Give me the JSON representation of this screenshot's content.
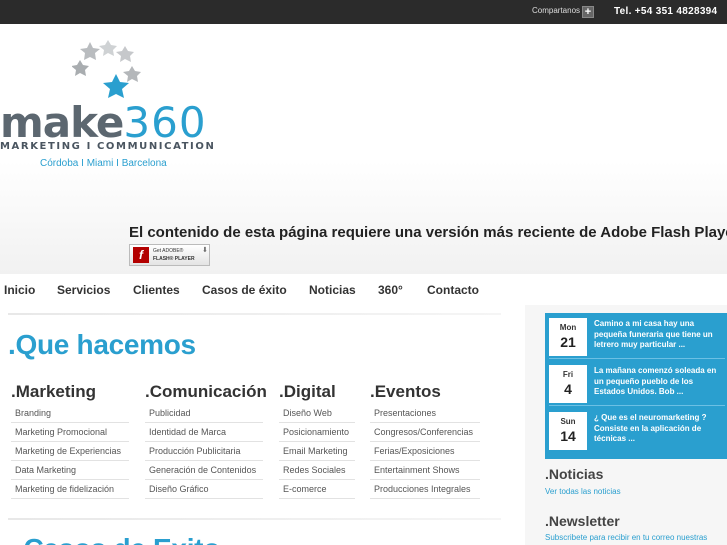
{
  "topbar": {
    "share_label": "Compartanos",
    "phone": "Tel. +54 351 4828394"
  },
  "logo": {
    "name_part1": "make",
    "name_part2": "360",
    "tagline": "MARKETING I COMMUNICATION",
    "cities": "Córdoba  I  Miami  I  Barcelona"
  },
  "flash": {
    "message": "El contenido de esta página requiere una versión más reciente de Adobe Flash Player.",
    "button_line1": "Get ADOBE®",
    "button_line2": "FLASH® PLAYER"
  },
  "nav": [
    "Inicio",
    "Servicios",
    "Clientes",
    "Casos de éxito",
    "Noticias",
    "360°",
    "Contacto"
  ],
  "main": {
    "title": ".Que hacemos",
    "next_title": ".Casos de Exito",
    "columns": [
      {
        "title": ".Marketing",
        "items": [
          "Branding",
          "Marketing Promocional",
          "Marketing de Experiencias",
          "Data Marketing",
          "Marketing de fidelización"
        ]
      },
      {
        "title": ".Comunicación",
        "items": [
          "Publicidad",
          "Identidad de Marca",
          "Producción Publicitaria",
          "Generación de Contenidos",
          "Diseño Gráfico"
        ]
      },
      {
        "title": ".Digital",
        "items": [
          "Diseño Web",
          "Posicionamiento",
          "Email Marketing",
          "Redes Sociales",
          "E-comerce"
        ]
      },
      {
        "title": ".Eventos",
        "items": [
          "Presentaciones",
          "Congresos/Conferencias",
          "Ferias/Exposiciones",
          "Entertainment Shows",
          "Producciones Integrales"
        ]
      }
    ]
  },
  "sidebar": {
    "news": [
      {
        "day": "Mon",
        "date": "21",
        "text": "Camino a mi casa hay una pequeña funeraria que tiene un letrero muy particular ..."
      },
      {
        "day": "Fri",
        "date": "4",
        "text": "La mañana comenzó soleada en un pequeño pueblo de los Estados Unidos. Bob ..."
      },
      {
        "day": "Sun",
        "date": "14",
        "text": "¿ Que es el neuromarketing ? Consiste en la aplicación de técnicas ..."
      }
    ],
    "noticias_title": ".Noticias",
    "noticias_link": "Ver todas las noticias",
    "newsletter_title": ".Newsletter",
    "newsletter_text": "Subscribete para recibir en tu correo nuestras"
  },
  "colors": {
    "accent": "#2a9fcf",
    "topbar": "#2b2b2b",
    "logo_gray": "#5c6770"
  }
}
